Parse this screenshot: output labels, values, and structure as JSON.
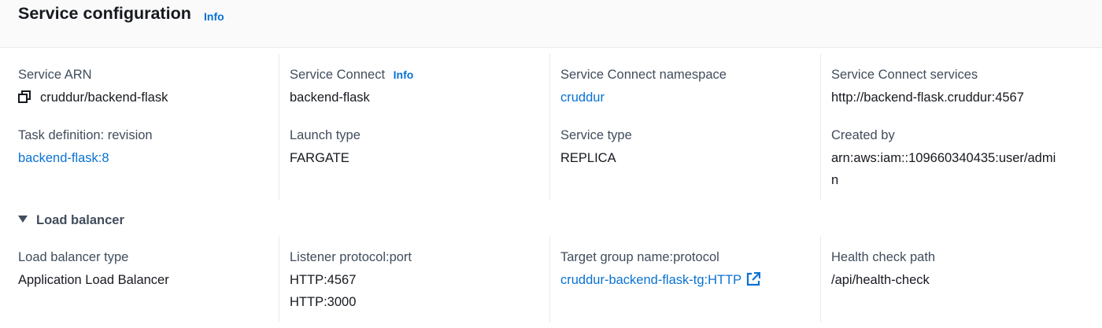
{
  "header": {
    "title": "Service configuration",
    "info": "Info"
  },
  "top": {
    "service_arn": {
      "label": "Service ARN",
      "value": "cruddur/backend-flask"
    },
    "task_definition": {
      "label": "Task definition: revision",
      "value": "backend-flask:8"
    },
    "service_connect": {
      "label": "Service Connect",
      "info": "Info",
      "value": "backend-flask"
    },
    "launch_type": {
      "label": "Launch type",
      "value": "FARGATE"
    },
    "namespace": {
      "label": "Service Connect namespace",
      "value": "cruddur"
    },
    "service_type": {
      "label": "Service type",
      "value": "REPLICA"
    },
    "connect_services": {
      "label": "Service Connect services",
      "value": "http://backend-flask.cruddur:4567"
    },
    "created_by": {
      "label": "Created by",
      "value": "arn:aws:iam::109660340435:user/admin"
    }
  },
  "load_balancer": {
    "toggle_label": "Load balancer",
    "type": {
      "label": "Load balancer type",
      "value": "Application Load Balancer"
    },
    "listener": {
      "label": "Listener protocol:port",
      "values": [
        "HTTP:4567",
        "HTTP:3000"
      ]
    },
    "target_group": {
      "label": "Target group name:protocol",
      "value": "cruddur-backend-flask-tg:HTTP"
    },
    "health_check": {
      "label": "Health check path",
      "value": "/api/health-check"
    }
  },
  "icons": {
    "copy": "copy-icon",
    "external": "external-link-icon",
    "caret": "caret-down-icon"
  },
  "colors": {
    "link": "#0972d3",
    "text": "#16191f",
    "label": "#414d5c",
    "header_bg": "#fafafa"
  }
}
